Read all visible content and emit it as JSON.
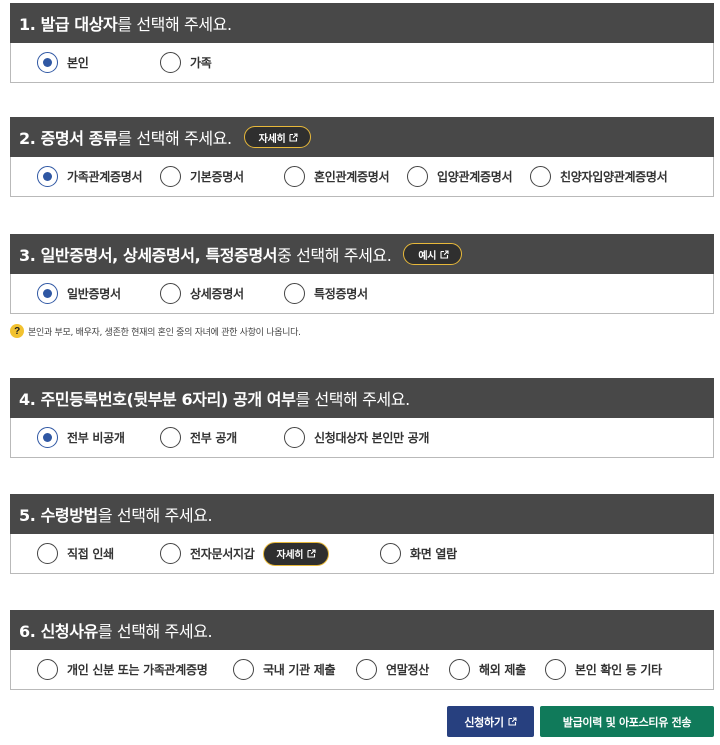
{
  "sections": [
    {
      "head_bold": "1. 발급 대상자",
      "head_rest": "를 선택해 주세요.",
      "options": [
        {
          "label": "본인",
          "checked": true
        },
        {
          "label": "가족",
          "checked": false
        }
      ]
    },
    {
      "head_bold": "2. 증명서 종류",
      "head_rest": "를 선택해 주세요.",
      "detail_label": "자세히",
      "options": [
        {
          "label": "가족관계증명서",
          "checked": true
        },
        {
          "label": "기본증명서",
          "checked": false
        },
        {
          "label": "혼인관계증명서",
          "checked": false
        },
        {
          "label": "입양관계증명서",
          "checked": false
        },
        {
          "label": "친양자입양관계증명서",
          "checked": false
        }
      ]
    },
    {
      "head_bold": "3. 일반증명서, 상세증명서, 특정증명서",
      "head_rest": " 중 선택해 주세요.",
      "detail_label": "예시",
      "options": [
        {
          "label": "일반증명서",
          "checked": true
        },
        {
          "label": "상세증명서",
          "checked": false
        },
        {
          "label": "특정증명서",
          "checked": false
        }
      ],
      "note": "본인과 부모, 배우자, 생존한 현재의 혼인 중의 자녀에 관한 사항이 나옵니다."
    },
    {
      "head_bold": "4. 주민등록번호(뒷부분 6자리) 공개 여부",
      "head_rest": "를 선택해 주세요.",
      "options": [
        {
          "label": "전부 비공개",
          "checked": true
        },
        {
          "label": "전부 공개",
          "checked": false
        },
        {
          "label": "신청대상자 본인만 공개",
          "checked": false
        }
      ]
    },
    {
      "head_bold": "5. 수령방법",
      "head_rest": "을 선택해 주세요.",
      "inline_detail_label": "자세히",
      "options": [
        {
          "label": "직접 인쇄",
          "checked": false
        },
        {
          "label": "전자문서지갑",
          "checked": false
        },
        {
          "label": "화면 열람",
          "checked": false
        }
      ]
    },
    {
      "head_bold": "6. 신청사유",
      "head_rest": "를 선택해 주세요.",
      "options": [
        {
          "label": "개인 신분 또는 가족관계증명",
          "checked": false
        },
        {
          "label": "국내 기관 제출",
          "checked": false
        },
        {
          "label": "연말정산",
          "checked": false
        },
        {
          "label": "해외 제출",
          "checked": false
        },
        {
          "label": "본인 확인 등 기타",
          "checked": false
        }
      ]
    }
  ],
  "buttons": {
    "apply_label": "신청하기",
    "send_label": "발급이력 및 아포스티유 전송"
  },
  "colors": {
    "header_bg": "#484848",
    "radio_accent": "#2f57a3",
    "detail_border": "#e7b83a",
    "apply_bg": "#27407f",
    "send_bg": "#107a5a"
  },
  "icons": {
    "external_link": "external-link-icon",
    "help": "question-icon"
  }
}
